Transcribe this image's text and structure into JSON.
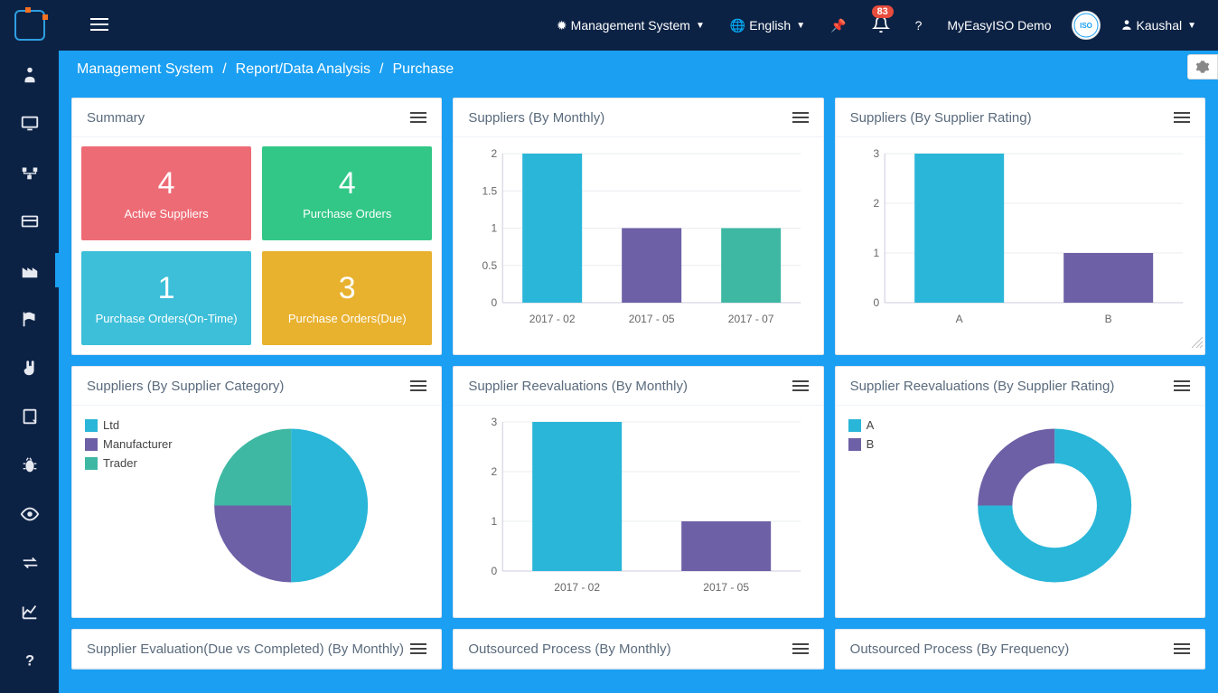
{
  "topbar": {
    "management_label": "Management System",
    "language_label": "English",
    "notifications_count": "83",
    "brand_label": "MyEasyISO Demo",
    "username": "Kaushal"
  },
  "breadcrumb": {
    "a": "Management System",
    "b": "Report/Data Analysis",
    "c": "Purchase"
  },
  "summary": {
    "title": "Summary",
    "tiles": [
      {
        "value": "4",
        "label": "Active Suppliers"
      },
      {
        "value": "4",
        "label": "Purchase Orders"
      },
      {
        "value": "1",
        "label": "Purchase Orders(On-Time)"
      },
      {
        "value": "3",
        "label": "Purchase Orders(Due)"
      }
    ]
  },
  "panels": {
    "p2": "Suppliers (By Monthly)",
    "p3": "Suppliers (By Supplier Rating)",
    "p4": "Suppliers (By Supplier Category)",
    "p5": "Supplier Reevaluations (By Monthly)",
    "p6": "Supplier Reevaluations (By Supplier Rating)",
    "p7": "Supplier Evaluation(Due vs Completed) (By Monthly)",
    "p8": "Outsourced Process (By Monthly)",
    "p9": "Outsourced Process (By Frequency)"
  },
  "chart_data": [
    {
      "id": "suppliers_monthly",
      "type": "bar",
      "categories": [
        "2017 - 02",
        "2017 - 05",
        "2017 - 07"
      ],
      "values": [
        2,
        1,
        1
      ],
      "series_colors": [
        "#29b6d8",
        "#6e60a6",
        "#3eb8a3"
      ],
      "ylim": [
        0,
        2
      ],
      "yticks": [
        0,
        0.5,
        1.0,
        1.5,
        2.0
      ]
    },
    {
      "id": "suppliers_rating",
      "type": "bar",
      "categories": [
        "A",
        "B"
      ],
      "values": [
        3,
        1
      ],
      "series_colors": [
        "#29b6d8",
        "#6e60a6"
      ],
      "ylim": [
        0,
        3
      ],
      "yticks": [
        0,
        1,
        2,
        3
      ]
    },
    {
      "id": "suppliers_category",
      "type": "pie",
      "series": [
        {
          "name": "Ltd",
          "value": 2,
          "color": "#29b6d8"
        },
        {
          "name": "Manufacturer",
          "value": 1,
          "color": "#6e60a6"
        },
        {
          "name": "Trader",
          "value": 1,
          "color": "#3eb8a3"
        }
      ]
    },
    {
      "id": "reeval_monthly",
      "type": "bar",
      "categories": [
        "2017 - 02",
        "2017 - 05"
      ],
      "values": [
        3,
        1
      ],
      "series_colors": [
        "#29b6d8",
        "#6e60a6"
      ],
      "ylim": [
        0,
        3
      ],
      "yticks": [
        0,
        1,
        2,
        3
      ]
    },
    {
      "id": "reeval_rating",
      "type": "pie",
      "donut": true,
      "series": [
        {
          "name": "A",
          "value": 3,
          "color": "#29b6d8"
        },
        {
          "name": "B",
          "value": 1,
          "color": "#6e60a6"
        }
      ]
    }
  ],
  "colors": {
    "blue": "#29b6d8",
    "purple": "#6e60a6",
    "teal": "#3eb8a3"
  },
  "legends": {
    "category": [
      "Ltd",
      "Manufacturer",
      "Trader"
    ],
    "rating": [
      "A",
      "B"
    ]
  }
}
